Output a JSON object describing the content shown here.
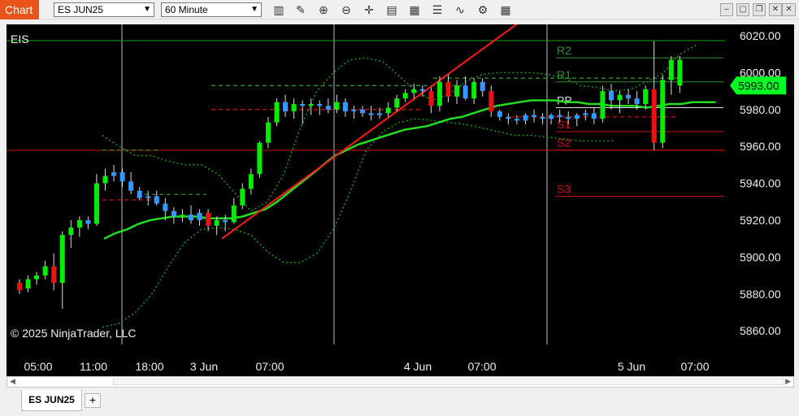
{
  "titlebar": {
    "chart_label": "Chart",
    "instrument": "ES JUN25",
    "interval": "60 Minute",
    "toolbar_icons": [
      "bar-type-icon",
      "draw-pencil-icon",
      "zoom-in-icon",
      "zoom-out-icon",
      "crosshair-icon",
      "templates-icon",
      "data-box-icon",
      "properties-icon",
      "indicators-icon",
      "strategies-icon",
      "grid-icon"
    ],
    "window_buttons": [
      "minimize",
      "maximize",
      "restore",
      "close"
    ]
  },
  "chart": {
    "symbol_label": "EIS",
    "copyright": "© 2025 NinjaTrader, LLC",
    "price_box": "5993.00",
    "colors": {
      "up": "#00ee00",
      "down": "#ee1111",
      "neutral": "#3399ff",
      "ma": "#22dd22",
      "band": "#1a8f1a",
      "pivot_r": "#2f8f2f",
      "pivot_s": "#cc1111",
      "trend": "#ff1a1a"
    },
    "pivot_labels": [
      "R2",
      "R1",
      "PP",
      "S1",
      "S2",
      "S3"
    ]
  },
  "tabs": {
    "active": "ES JUN25",
    "add": "+"
  },
  "chart_data": {
    "type": "candlestick",
    "y_ticks": [
      "6020.00",
      "6000.00",
      "5980.00",
      "5960.00",
      "5940.00",
      "5920.00",
      "5900.00",
      "5880.00",
      "5860.00"
    ],
    "ylim": [
      5853,
      6026
    ],
    "x_ticks": [
      "05:00",
      "11:00",
      "18:00",
      "3 Jun",
      "07:00",
      "4 Jun",
      "07:00",
      "5 Jun",
      "07:00"
    ],
    "candles": [
      [
        5886,
        5888,
        5880,
        5882
      ],
      [
        5883,
        5890,
        5881,
        5888
      ],
      [
        5888,
        5892,
        5885,
        5890
      ],
      [
        5890,
        5898,
        5888,
        5895
      ],
      [
        5895,
        5902,
        5882,
        5886
      ],
      [
        5886,
        5914,
        5872,
        5912
      ],
      [
        5912,
        5920,
        5905,
        5916
      ],
      [
        5916,
        5922,
        5911,
        5920
      ],
      [
        5920,
        5922,
        5915,
        5918
      ],
      [
        5918,
        5945,
        5917,
        5940
      ],
      [
        5940,
        5948,
        5936,
        5944
      ],
      [
        5944,
        5950,
        5941,
        5946
      ],
      [
        5946,
        5948,
        5938,
        5941
      ],
      [
        5941,
        5946,
        5934,
        5936
      ],
      [
        5936,
        5938,
        5931,
        5932
      ],
      [
        5932,
        5936,
        5928,
        5933
      ],
      [
        5933,
        5936,
        5928,
        5929
      ],
      [
        5929,
        5932,
        5920,
        5925
      ],
      [
        5925,
        5927,
        5918,
        5922
      ],
      [
        5922,
        5926,
        5919,
        5923
      ],
      [
        5923,
        5928,
        5918,
        5920
      ],
      [
        5920,
        5926,
        5917,
        5924
      ],
      [
        5924,
        5926,
        5914,
        5917
      ],
      [
        5917,
        5922,
        5912,
        5920
      ],
      [
        5920,
        5923,
        5914,
        5919
      ],
      [
        5919,
        5932,
        5918,
        5928
      ],
      [
        5928,
        5940,
        5926,
        5937
      ],
      [
        5937,
        5948,
        5934,
        5945
      ],
      [
        5945,
        5963,
        5943,
        5962
      ],
      [
        5962,
        5976,
        5959,
        5973
      ],
      [
        5973,
        5986,
        5971,
        5984
      ],
      [
        5984,
        5988,
        5976,
        5979
      ],
      [
        5979,
        5986,
        5975,
        5983
      ],
      [
        5983,
        5985,
        5972,
        5982
      ],
      [
        5982,
        5986,
        5977,
        5983
      ],
      [
        5983,
        5985,
        5977,
        5982
      ],
      [
        5982,
        5986,
        5978,
        5980
      ],
      [
        5980,
        5988,
        5978,
        5984
      ],
      [
        5984,
        5986,
        5976,
        5979
      ],
      [
        5979,
        5982,
        5975,
        5980
      ],
      [
        5980,
        5982,
        5976,
        5978
      ],
      [
        5978,
        5982,
        5974,
        5977
      ],
      [
        5977,
        5981,
        5975,
        5978
      ],
      [
        5978,
        5984,
        5976,
        5981
      ],
      [
        5981,
        5988,
        5979,
        5986
      ],
      [
        5986,
        5991,
        5984,
        5989
      ],
      [
        5989,
        5994,
        5986,
        5991
      ],
      [
        5991,
        5993,
        5987,
        5990
      ],
      [
        5990,
        5992,
        5978,
        5982
      ],
      [
        5982,
        5998,
        5979,
        5995
      ],
      [
        5995,
        5999,
        5984,
        5987
      ],
      [
        5987,
        5996,
        5983,
        5993
      ],
      [
        5993,
        5998,
        5985,
        5986
      ],
      [
        5986,
        5997,
        5983,
        5995
      ],
      [
        5995,
        5997,
        5987,
        5990
      ],
      [
        5990,
        5993,
        5976,
        5979
      ],
      [
        5979,
        5980,
        5974,
        5976
      ],
      [
        5976,
        5978,
        5972,
        5975
      ],
      [
        5975,
        5977,
        5972,
        5974
      ],
      [
        5974,
        5978,
        5972,
        5977
      ],
      [
        5977,
        5980,
        5973,
        5976
      ],
      [
        5976,
        5978,
        5972,
        5975
      ],
      [
        5975,
        5978,
        5972,
        5977
      ],
      [
        5977,
        5980,
        5973,
        5976
      ],
      [
        5976,
        5979,
        5972,
        5975
      ],
      [
        5975,
        5978,
        5971,
        5977
      ],
      [
        5977,
        5980,
        5974,
        5978
      ],
      [
        5978,
        5981,
        5972,
        5975
      ],
      [
        5975,
        5993,
        5973,
        5990
      ],
      [
        5990,
        5994,
        5980,
        5985
      ],
      [
        5985,
        5990,
        5978,
        5988
      ],
      [
        5988,
        5991,
        5983,
        5986
      ],
      [
        5986,
        5990,
        5980,
        5983
      ],
      [
        5983,
        5993,
        5980,
        5991
      ],
      [
        5991,
        6017,
        5958,
        5962
      ],
      [
        5962,
        5999,
        5959,
        5996
      ],
      [
        5996,
        6009,
        5988,
        6007
      ],
      [
        6007,
        6009,
        5989,
        5993
      ]
    ],
    "candle_colors": [
      "r",
      "g",
      "g",
      "g",
      "r",
      "g",
      "g",
      "g",
      "b",
      "g",
      "g",
      "b",
      "b",
      "b",
      "b",
      "b",
      "b",
      "b",
      "b",
      "g",
      "b",
      "b",
      "r",
      "g",
      "b",
      "g",
      "g",
      "g",
      "g",
      "g",
      "g",
      "b",
      "g",
      "b",
      "g",
      "b",
      "b",
      "g",
      "b",
      "b",
      "b",
      "b",
      "b",
      "g",
      "g",
      "g",
      "g",
      "b",
      "r",
      "g",
      "r",
      "g",
      "b",
      "g",
      "b",
      "r",
      "b",
      "b",
      "b",
      "b",
      "b",
      "b",
      "b",
      "b",
      "b",
      "b",
      "b",
      "b",
      "g",
      "b",
      "g",
      "b",
      "b",
      "g",
      "r",
      "g",
      "g",
      "g"
    ],
    "ma": [
      5910,
      5913,
      5915,
      5918,
      5920,
      5921,
      5922,
      5922,
      5922,
      5921,
      5921,
      5921,
      5922,
      5924,
      5926,
      5930,
      5935,
      5940,
      5945,
      5950,
      5955,
      5958,
      5961,
      5963,
      5965,
      5967,
      5969,
      5970,
      5971,
      5973,
      5975,
      5976,
      5978,
      5980,
      5982,
      5983,
      5984,
      5985,
      5985,
      5985,
      5984,
      5984,
      5983,
      5983,
      5982,
      5982,
      5982,
      5981,
      5982,
      5983,
      5983,
      5984,
      5984,
      5984
    ],
    "band_upper": [
      5966,
      5960,
      5955,
      5955,
      5952,
      5950,
      5950,
      5945,
      5935,
      5925,
      5930,
      5945,
      5970,
      5990,
      6000,
      6007,
      6008,
      6006,
      5998,
      5990,
      5985,
      5988,
      5995,
      5999,
      6000,
      6000,
      6000,
      5999,
      5997,
      5993,
      5992,
      5990,
      5991,
      5995,
      6000,
      6010,
      6015
    ],
    "band_lower": [
      5862,
      5864,
      5870,
      5880,
      5895,
      5908,
      5915,
      5916,
      5915,
      5912,
      5903,
      5897,
      5897,
      5902,
      5915,
      5935,
      5958,
      5968,
      5973,
      5975,
      5974,
      5973,
      5972,
      5970,
      5968,
      5966,
      5966,
      5965,
      5964,
      5963,
      5963,
      5963
    ],
    "pivots": {
      "R2": 6008,
      "R1": 5995,
      "PP": 5981,
      "S1": 5968,
      "S2": 5958,
      "S3": 5933
    }
  }
}
